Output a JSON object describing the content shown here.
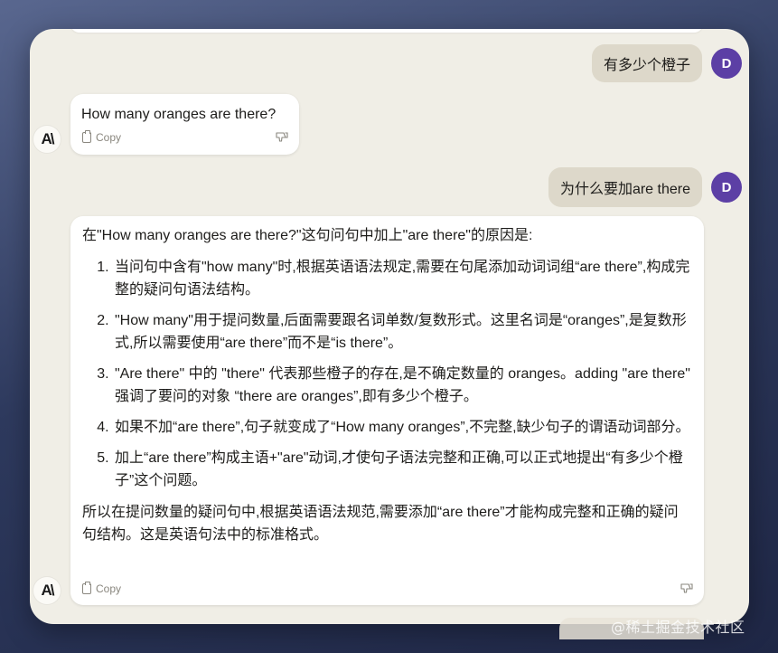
{
  "conversation": {
    "messages": [
      {
        "role": "user",
        "text": "有多少个橙子",
        "avatar": "D"
      },
      {
        "role": "assistant",
        "text": "How many oranges are there?",
        "copy_label": "Copy"
      },
      {
        "role": "user",
        "text": "为什么要加are there",
        "avatar": "D"
      },
      {
        "role": "assistant",
        "intro": "在\"How many oranges are there?\"这句问句中加上\"are there\"的原因是:",
        "points": [
          "当问句中含有\"how many\"时,根据英语语法规定,需要在句尾添加动词词组“are there”,构成完整的疑问句语法结构。",
          "\"How many\"用于提问数量,后面需要跟名词单数/复数形式。这里名词是“oranges”,是复数形式,所以需要使用“are there”而不是“is there”。",
          "\"Are there\" 中的 \"there\" 代表那些橙子的存在,是不确定数量的 oranges。adding \"are there\" 强调了要问的对象 “there are oranges”,即有多少个橙子。",
          "如果不加“are there”,句子就变成了“How many oranges”,不完整,缺少句子的谓语动词部分。",
          "加上“are there”构成主语+\"are\"动词,才使句子语法完整和正确,可以正式地提出“有多少个橙子”这个问题。"
        ],
        "conclusion": "所以在提问数量的疑问句中,根据英语语法规范,需要添加“are there”才能构成完整和正确的疑问句结构。这是英语句法中的标准格式。",
        "copy_label": "Copy"
      }
    ],
    "assistant_logo": "A\\"
  },
  "watermark": "@稀土掘金技术社区",
  "colors": {
    "user_bubble": "#ddd8ca",
    "avatar": "#5c3fa5",
    "window": "#f0eee6"
  }
}
